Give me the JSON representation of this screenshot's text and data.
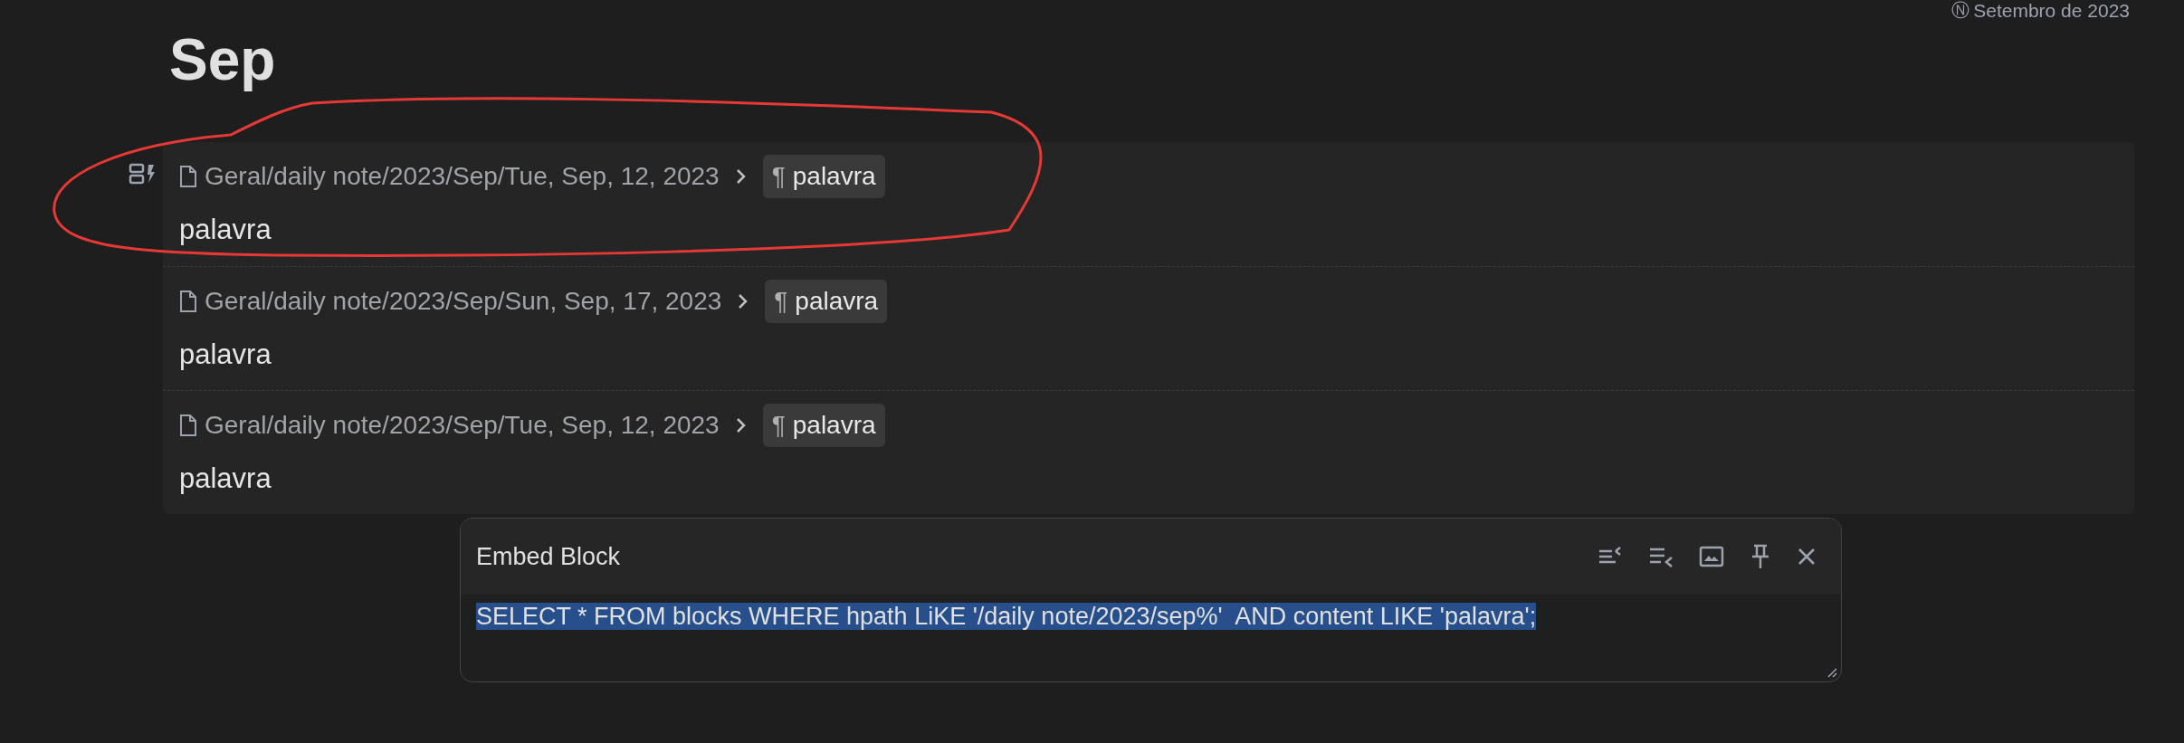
{
  "header_date": {
    "icon": "Ⓝ",
    "text": "Setembro de 2023"
  },
  "title": "Sep",
  "results": [
    {
      "path": "Geral/daily note/2023/Sep/Tue, Sep, 12, 2023",
      "mark": "¶",
      "anchor": "palavra",
      "content": "palavra"
    },
    {
      "path": "Geral/daily note/2023/Sep/Sun, Sep, 17, 2023",
      "mark": "¶",
      "anchor": "palavra",
      "content": "palavra"
    },
    {
      "path": "Geral/daily note/2023/Sep/Tue, Sep, 12, 2023",
      "mark": "¶",
      "anchor": "palavra",
      "content": "palavra"
    }
  ],
  "dialog": {
    "title": "Embed Block",
    "query": "SELECT * FROM blocks WHERE hpath LiKE '/daily note/2023/sep%'  AND content LIKE 'palavra';",
    "query_selected": true
  }
}
